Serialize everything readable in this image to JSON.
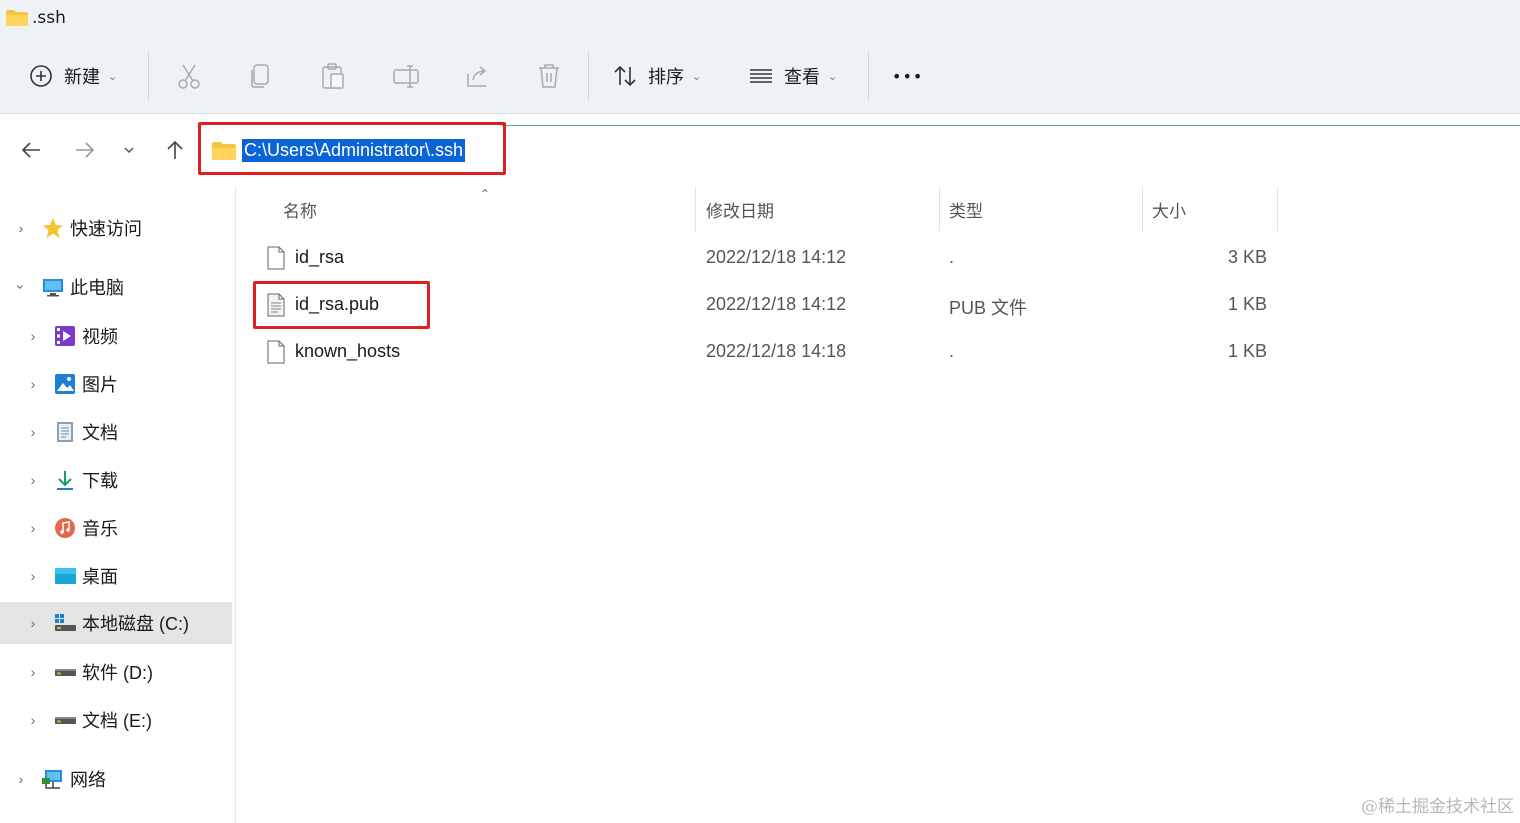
{
  "window": {
    "title": ".ssh"
  },
  "toolbar": {
    "new_label": "新建",
    "sort_label": "排序",
    "view_label": "查看",
    "more_label": "•••"
  },
  "address": {
    "path": "C:\\Users\\Administrator\\.ssh"
  },
  "sidebar": {
    "items": [
      {
        "label": "快速访问",
        "icon": "star-icon"
      },
      {
        "label": "此电脑",
        "icon": "computer-icon"
      },
      {
        "label": "视频",
        "icon": "video-icon"
      },
      {
        "label": "图片",
        "icon": "picture-icon"
      },
      {
        "label": "文档",
        "icon": "document-icon"
      },
      {
        "label": "下载",
        "icon": "download-icon"
      },
      {
        "label": "音乐",
        "icon": "music-icon"
      },
      {
        "label": "桌面",
        "icon": "desktop-icon"
      },
      {
        "label": "本地磁盘 (C:)",
        "icon": "drive-c-icon"
      },
      {
        "label": "软件 (D:)",
        "icon": "drive-icon"
      },
      {
        "label": "文档 (E:)",
        "icon": "drive-icon"
      },
      {
        "label": "网络",
        "icon": "network-icon"
      }
    ]
  },
  "columns": {
    "name": "名称",
    "modified": "修改日期",
    "type": "类型",
    "size": "大小"
  },
  "files": [
    {
      "name": "id_rsa",
      "modified": "2022/12/18 14:12",
      "type": ".",
      "size": "3 KB"
    },
    {
      "name": "id_rsa.pub",
      "modified": "2022/12/18 14:12",
      "type": "PUB 文件",
      "size": "1 KB"
    },
    {
      "name": "known_hosts",
      "modified": "2022/12/18 14:18",
      "type": ".",
      "size": "1 KB"
    }
  ],
  "watermark": "@稀土掘金技术社区",
  "colors": {
    "highlight_box": "#e02020",
    "selection": "#0a64d8",
    "folder": "#f5c542"
  }
}
